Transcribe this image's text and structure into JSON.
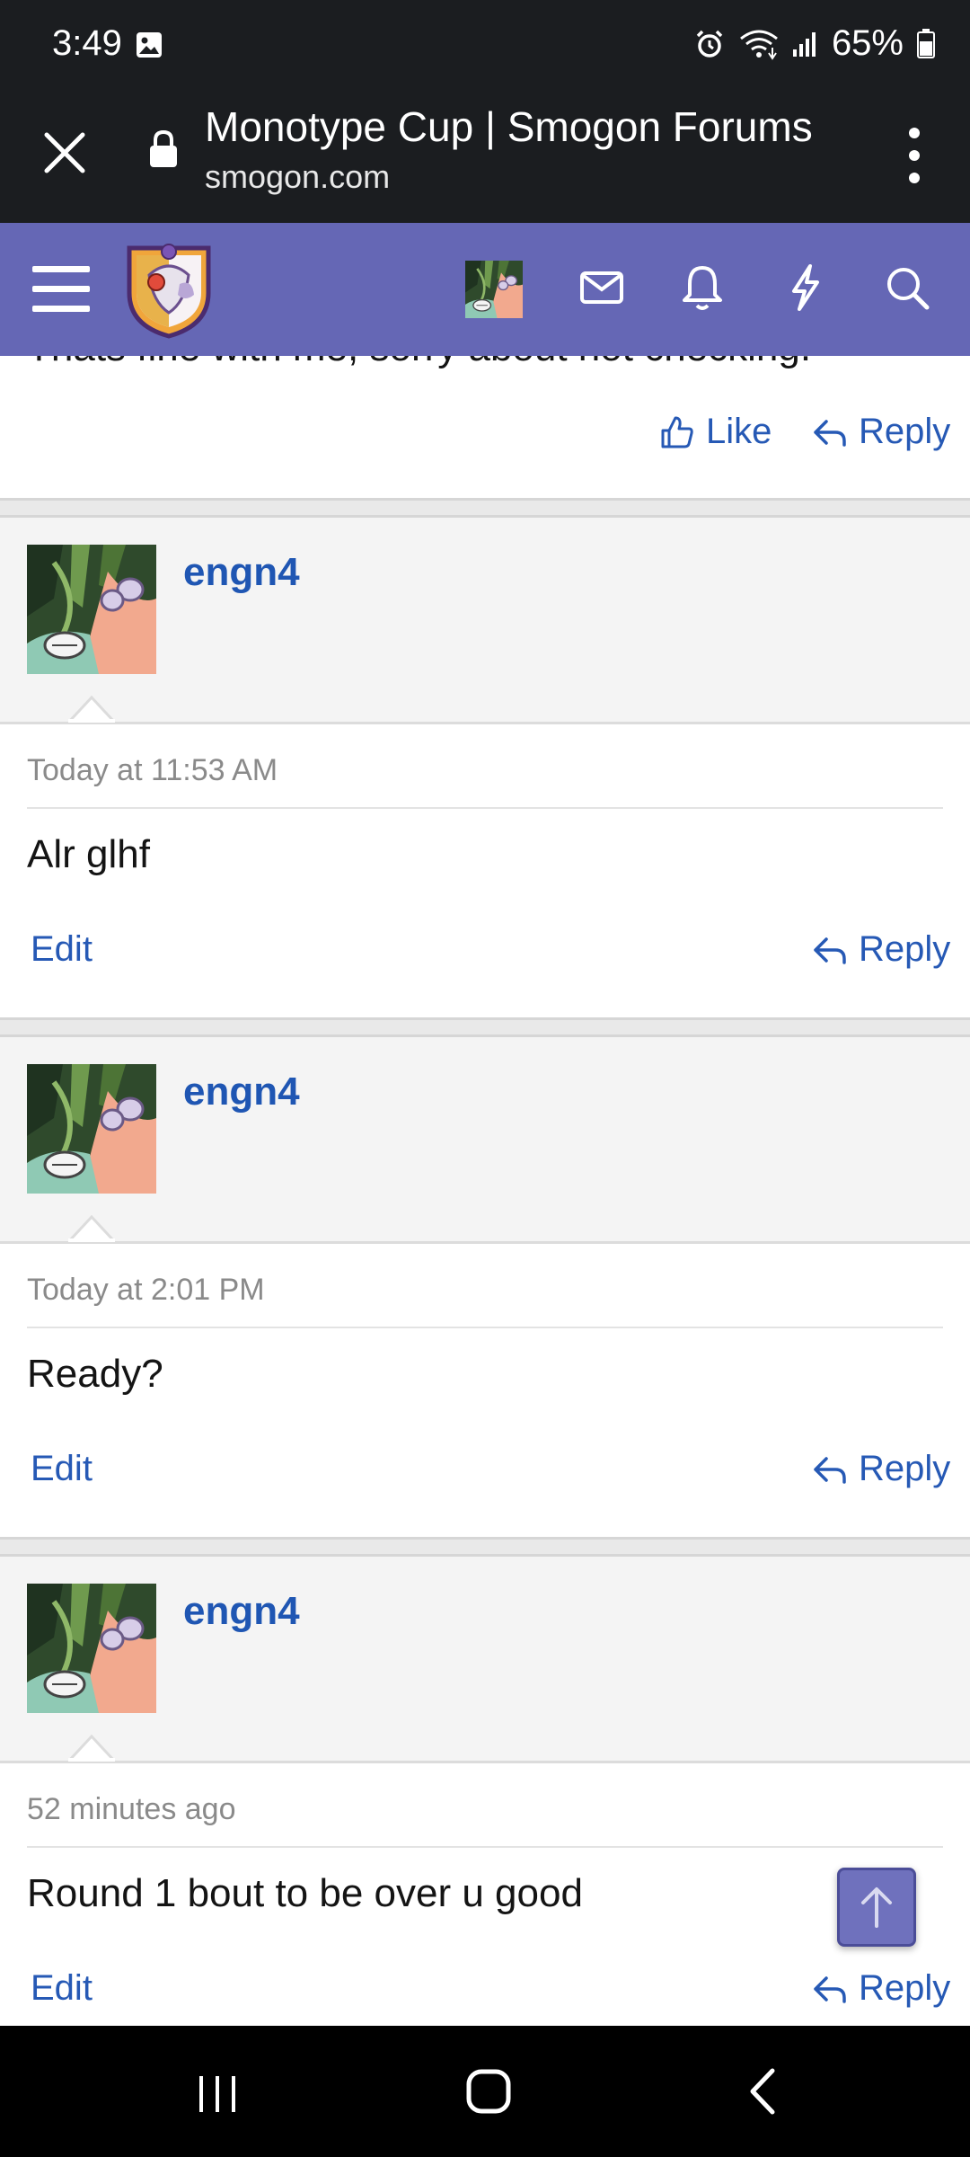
{
  "status_bar": {
    "time": "3:49",
    "battery": "65%"
  },
  "browser": {
    "title": "Monotype Cup | Smogon Forums",
    "domain": "smogon.com"
  },
  "colors": {
    "header_bg": "#6567b5",
    "link": "#2659b5",
    "username": "#1f56b3"
  },
  "previous_post": {
    "cutoff_text": "Thats fine with me, sorry about not checking.",
    "like_label": "Like",
    "reply_label": "Reply"
  },
  "posts": [
    {
      "username": "engn4",
      "time": "Today at 11:53 AM",
      "body": "Alr glhf",
      "edit_label": "Edit",
      "reply_label": "Reply"
    },
    {
      "username": "engn4",
      "time": "Today at 2:01 PM",
      "body": "Ready?",
      "edit_label": "Edit",
      "reply_label": "Reply"
    },
    {
      "username": "engn4",
      "time": "52 minutes ago",
      "body": "Round 1 bout to be over u good",
      "edit_label": "Edit",
      "reply_label": "Reply"
    }
  ]
}
